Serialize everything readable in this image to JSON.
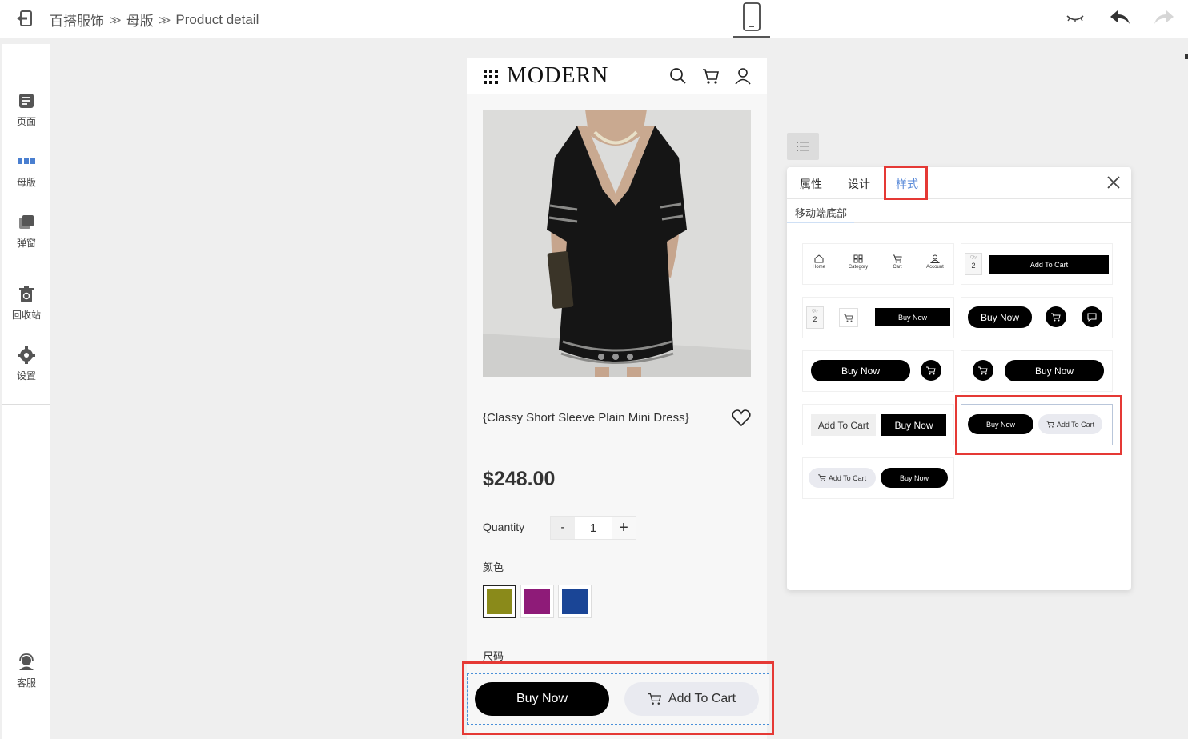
{
  "topbar": {
    "breadcrumb": [
      "百搭服饰",
      "母版",
      "Product detail"
    ]
  },
  "sidebar": {
    "items": [
      {
        "label": "页面",
        "icon": "page-icon"
      },
      {
        "label": "母版",
        "icon": "master-icon"
      },
      {
        "label": "弹窗",
        "icon": "popup-icon"
      },
      {
        "label": "回收站",
        "icon": "recycle-bin-icon"
      },
      {
        "label": "设置",
        "icon": "settings-gear-icon"
      },
      {
        "label": "客服",
        "icon": "customer-service-icon"
      }
    ]
  },
  "phone": {
    "brand": "MODERN",
    "product_title": "{Classy Short Sleeve Plain Mini Dress}",
    "price": "$248.00",
    "quantity_label": "Quantity",
    "qty_minus": "-",
    "qty_value": "1",
    "qty_plus": "+",
    "color_label": "颜色",
    "colors": [
      "#8a8a1a",
      "#8e1b78",
      "#1a4596"
    ],
    "size_label": "尺码",
    "buy_now": "Buy Now",
    "add_to_cart": "Add To Cart"
  },
  "panel": {
    "tabs": [
      "属性",
      "设计",
      "样式"
    ],
    "active_tab": "样式",
    "subtab": "移动端底部",
    "tiles": {
      "nav": [
        "Home",
        "Category",
        "Cart",
        "Account"
      ],
      "qty_caption": "Qty",
      "qty_value": "2",
      "add_to_cart": "Add To Cart",
      "buy_now": "Buy Now"
    }
  },
  "colors": {
    "accent_blue": "#5b8bd9",
    "highlight_red": "#e53935",
    "selection_dashed": "#4a90d9"
  }
}
